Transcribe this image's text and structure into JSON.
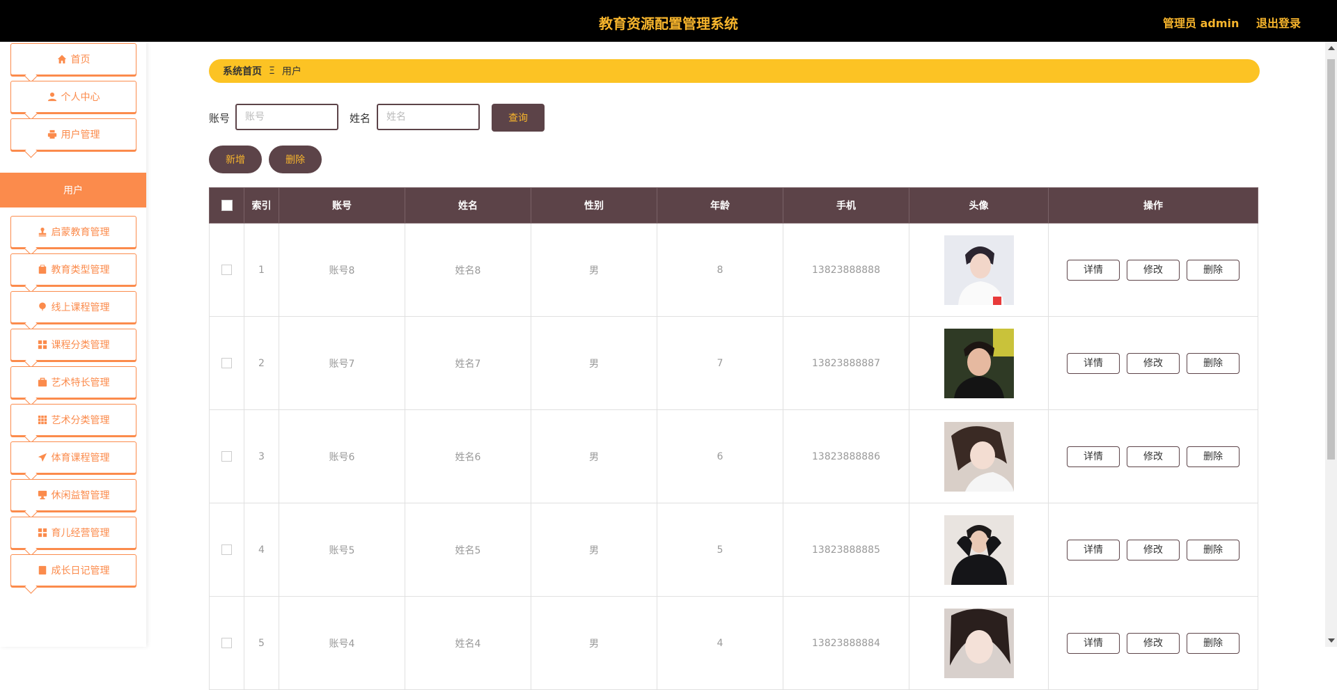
{
  "header": {
    "title": "教育资源配置管理系统",
    "user": "管理员 admin",
    "logout": "退出登录"
  },
  "sidebar": {
    "items": [
      {
        "label": "首页",
        "icon": "home-icon"
      },
      {
        "label": "个人中心",
        "icon": "person-icon"
      },
      {
        "label": "用户管理",
        "icon": "printer-icon"
      },
      {
        "label": "启蒙教育管理",
        "icon": "stamp-icon"
      },
      {
        "label": "教育类型管理",
        "icon": "clipboard-icon"
      },
      {
        "label": "线上课程管理",
        "icon": "balloon-icon"
      },
      {
        "label": "课程分类管理",
        "icon": "grid-icon"
      },
      {
        "label": "艺术特长管理",
        "icon": "briefcase-icon"
      },
      {
        "label": "艺术分类管理",
        "icon": "grid-nine-icon"
      },
      {
        "label": "体育课程管理",
        "icon": "send-icon"
      },
      {
        "label": "休闲益智管理",
        "icon": "monitor-icon"
      },
      {
        "label": "育儿经营管理",
        "icon": "grid-icon"
      },
      {
        "label": "成长日记管理",
        "icon": "book-icon"
      }
    ],
    "submenu": "用户"
  },
  "breadcrumb": {
    "home": "系统首页",
    "sep": "Ξ",
    "current": "用户"
  },
  "search": {
    "account_label": "账号",
    "account_placeholder": "账号",
    "name_label": "姓名",
    "name_placeholder": "姓名",
    "query_label": "查询"
  },
  "actions": {
    "add_label": "新增",
    "delete_label": "删除"
  },
  "table": {
    "headers": [
      "索引",
      "账号",
      "姓名",
      "性别",
      "年龄",
      "手机",
      "头像",
      "操作"
    ],
    "row_actions": [
      "详情",
      "修改",
      "删除"
    ],
    "rows": [
      {
        "index": "1",
        "account": "账号8",
        "name": "姓名8",
        "gender": "男",
        "age": "8",
        "phone": "13823888888"
      },
      {
        "index": "2",
        "account": "账号7",
        "name": "姓名7",
        "gender": "男",
        "age": "7",
        "phone": "13823888887"
      },
      {
        "index": "3",
        "account": "账号6",
        "name": "姓名6",
        "gender": "男",
        "age": "6",
        "phone": "13823888886"
      },
      {
        "index": "4",
        "account": "账号5",
        "name": "姓名5",
        "gender": "男",
        "age": "5",
        "phone": "13823888885"
      },
      {
        "index": "5",
        "account": "账号4",
        "name": "姓名4",
        "gender": "男",
        "age": "4",
        "phone": "13823888884"
      }
    ]
  },
  "colors": {
    "header_bg": "#000000",
    "accent": "#fb8b4c",
    "brand_dark": "#5c4348",
    "yellow": "#fcc324"
  }
}
